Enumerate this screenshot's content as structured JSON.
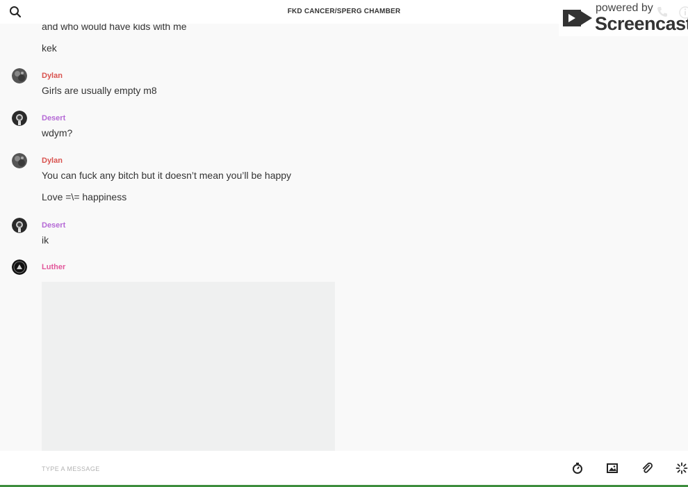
{
  "header": {
    "title": "FKD CANCER/SPERG CHAMBER",
    "icons": [
      "search-icon",
      "phone-icon",
      "info-icon"
    ]
  },
  "watermark": {
    "small": "powered by",
    "big": "Screencastify"
  },
  "messages": [
    {
      "lines": [
        "and who would have kids with me",
        "kek"
      ]
    },
    {
      "author": "Dylan",
      "author_color": "#d9534f",
      "lines": [
        "Girls are usually empty m8"
      ]
    },
    {
      "author": "Desert",
      "author_color": "#b56ad6",
      "lines": [
        "wdym?"
      ]
    },
    {
      "author": "Dylan",
      "author_color": "#d9534f",
      "lines": [
        "You can fuck any bitch but it doesn’t mean you’ll be happy",
        "Love =\\= happiness"
      ]
    },
    {
      "author": "Desert",
      "author_color": "#b56ad6",
      "lines": [
        "ik"
      ]
    },
    {
      "author": "Luther",
      "author_color": "#e2579b",
      "lines": [],
      "has_image": true
    }
  ],
  "composer": {
    "placeholder": "TYPE A MESSAGE",
    "tools": [
      "timer-icon",
      "image-icon",
      "attachment-icon",
      "sparkle-icon"
    ]
  },
  "colors": {
    "header_bg": "#ffffff",
    "chat_bg": "#f9f9f9",
    "image_placeholder": "#eff0f0",
    "bottom_bar": "#3c8d3c"
  }
}
